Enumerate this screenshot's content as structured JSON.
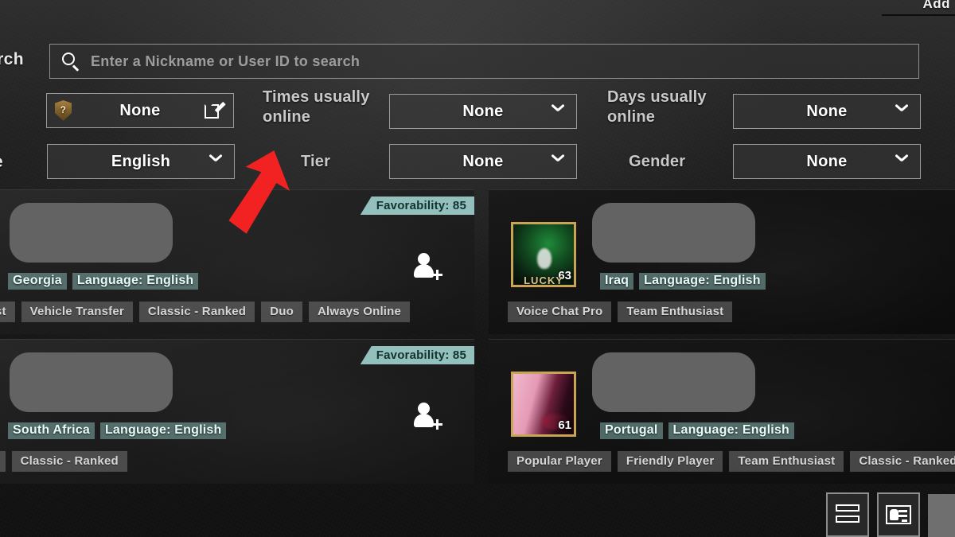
{
  "header": {
    "cut_label": "Add"
  },
  "filters": {
    "search_label": "arch",
    "search_placeholder": "Enter a Nickname or User ID to search",
    "search_icon": "search-icon",
    "language_label": "e",
    "language_value": "English",
    "tier_badge_label": "Tier",
    "tier_badge_value": "None",
    "edit_icon": "edit-icon",
    "shield_icon": "shield-question-icon",
    "times_online_label": "Times usually online",
    "times_online_value": "None",
    "tier_label": "Tier",
    "tier_value": "None",
    "days_online_label": "Days usually online",
    "days_online_value": "None",
    "gender_label": "Gender",
    "gender_value": "None"
  },
  "annotation": {
    "arrow_color": "#f32222",
    "arrow_points_to": "Tier"
  },
  "cards": [
    {
      "country": "Georgia",
      "language": "Language: English",
      "favorability": "Favorability: 85",
      "has_favorability": true,
      "has_add_friend": true,
      "avatar": null,
      "tags": [
        "iast",
        "Vehicle Transfer",
        "Classic - Ranked",
        "Duo",
        "Always Online"
      ]
    },
    {
      "country": "Iraq",
      "language": "Language: English",
      "favorability": "",
      "has_favorability": false,
      "has_add_friend": false,
      "avatar": {
        "level": "63",
        "subtitle": "LUCKY",
        "style": "green"
      },
      "tags": [
        "Voice Chat Pro",
        "Team Enthusiast"
      ]
    },
    {
      "country": "South Africa",
      "language": "Language: English",
      "favorability": "Favorability: 85",
      "has_favorability": true,
      "has_add_friend": true,
      "avatar": null,
      "tags": [
        "er",
        "Classic - Ranked"
      ]
    },
    {
      "country": "Portugal",
      "language": "Language: English",
      "favorability": "",
      "has_favorability": false,
      "has_add_friend": false,
      "avatar": {
        "level": "61",
        "subtitle": "",
        "style": "pink"
      },
      "tags": [
        "Popular Player",
        "Friendly Player",
        "Team Enthusiast",
        "Classic - Ranked"
      ]
    }
  ],
  "bottom_bar": {
    "list_view_icon": "list-view-icon",
    "card_view_icon": "card-view-icon"
  },
  "colors": {
    "teal_chip": "#93c0bc",
    "gold_frame": "#c9a454",
    "arrow_red": "#f32222",
    "panel_border": "#9b9b9b"
  }
}
